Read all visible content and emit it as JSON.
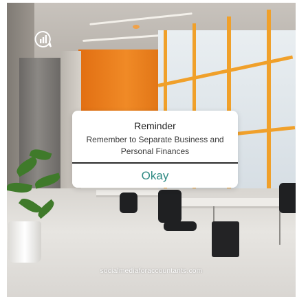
{
  "modal": {
    "title": "Reminder",
    "message": "Remember to Separate Business and Personal Finances",
    "button_label": "Okay"
  },
  "footer": {
    "website": "socialmediaforaccountants.com"
  },
  "colors": {
    "accent": "#2f8a83",
    "brand_orange": "#f08a26"
  },
  "icons": {
    "logo": "chart-bubble-icon"
  }
}
